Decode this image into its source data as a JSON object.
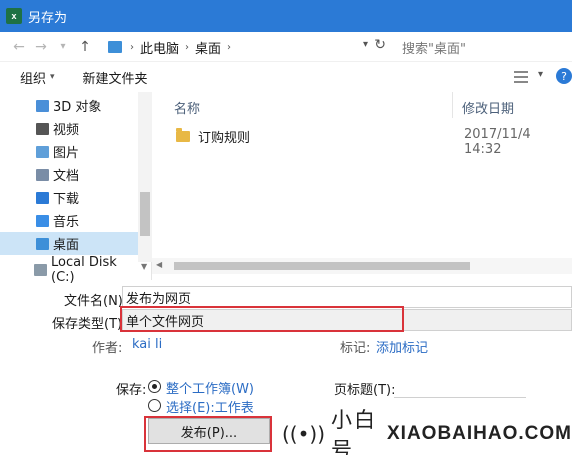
{
  "window": {
    "app_icon": "x",
    "title": "另存为"
  },
  "nav": {
    "path": [
      "此电脑",
      "桌面"
    ],
    "search_placeholder": "搜索\"桌面\""
  },
  "toolbar": {
    "organize": "组织",
    "new_folder": "新建文件夹"
  },
  "sidebar": {
    "items": [
      {
        "label": "3D 对象",
        "icon_color": "#4a8fd8"
      },
      {
        "label": "视频",
        "icon_color": "#555555"
      },
      {
        "label": "图片",
        "icon_color": "#5f9fd9"
      },
      {
        "label": "文档",
        "icon_color": "#7a8da6"
      },
      {
        "label": "下载",
        "icon_color": "#2b7ad6"
      },
      {
        "label": "音乐",
        "icon_color": "#3a8ee6"
      },
      {
        "label": "桌面",
        "icon_color": "#3d8fd8"
      },
      {
        "label": "Local Disk (C:)",
        "icon_color": "#8a9aa8"
      }
    ],
    "selected_index": 6
  },
  "file_list": {
    "columns": {
      "name": "名称",
      "modified": "修改日期"
    },
    "rows": [
      {
        "name": "订购规则",
        "modified": "2017/11/4 14:32"
      }
    ]
  },
  "form": {
    "filename_label": "文件名(N):",
    "filename_value": "发布为网页",
    "type_label": "保存类型(T):",
    "type_value": "单个文件网页",
    "author_label": "作者:",
    "author_value": "kai li",
    "tags_label": "标记:",
    "tags_value": "添加标记",
    "save_label": "保存:",
    "option_workbook": "整个工作簿(W)",
    "option_selection": "选择(E):工作表",
    "page_title_label": "页标题(T):",
    "publish_label": "发布(P)..."
  },
  "watermark": {
    "cn": "小白号",
    "en": "XIAOBAIHAO.COM"
  },
  "colors": {
    "titlebar": "#2b7ad6",
    "highlight": "#d9333a",
    "link": "#2b6cc4"
  }
}
